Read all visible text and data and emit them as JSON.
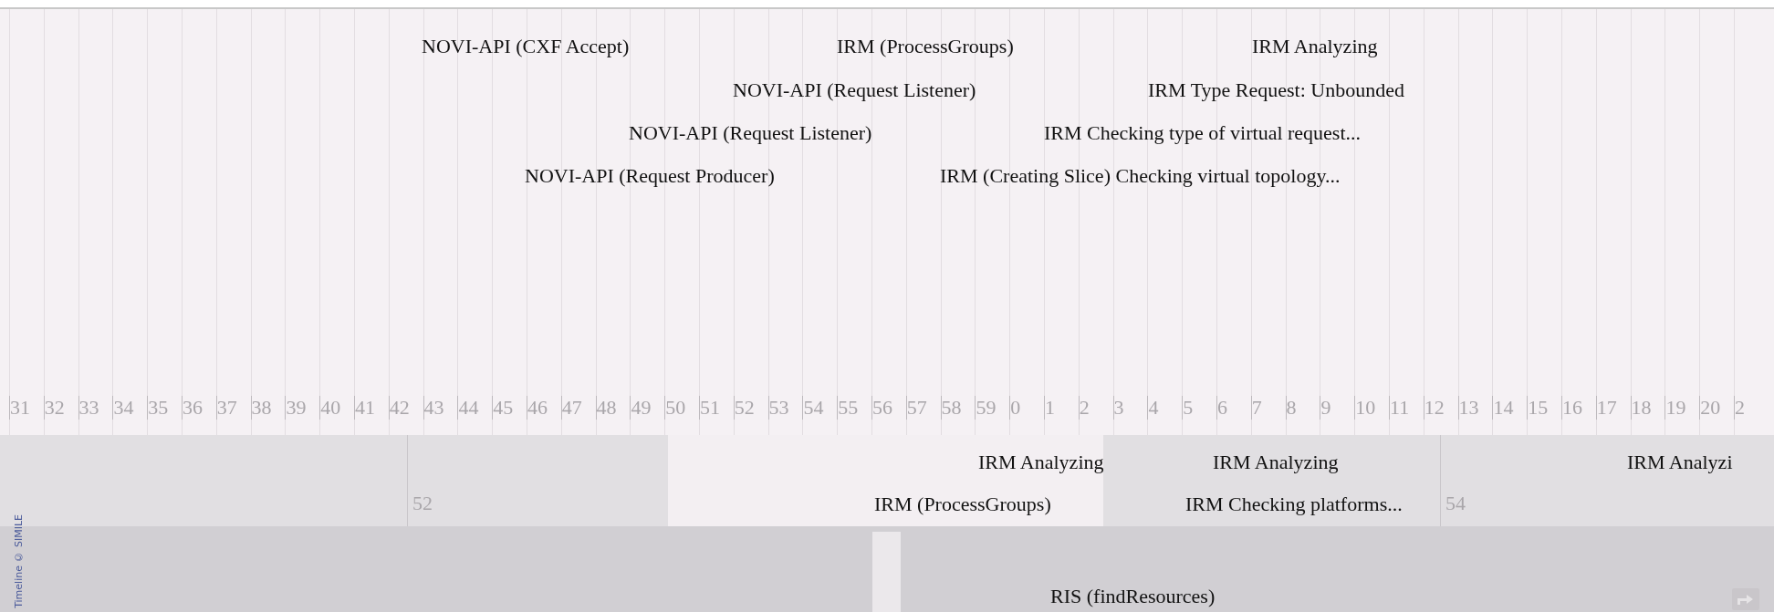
{
  "top_band": {
    "rows": [
      [
        "NOVI-API (CXF Accept)",
        "IRM (ProcessGroups)",
        "IRM Analyzing"
      ],
      [
        "NOVI-API (Request Listener)",
        "IRM Type Request: Unbounded"
      ],
      [
        "NOVI-API (Request Listener)",
        "IRM Checking type of virtual request..."
      ],
      [
        "NOVI-API (Request Producer)",
        "IRM (Creating Slice) Checking virtual topology..."
      ]
    ],
    "ticks": [
      "31",
      "32",
      "33",
      "34",
      "35",
      "36",
      "37",
      "38",
      "39",
      "40",
      "41",
      "42",
      "43",
      "44",
      "45",
      "46",
      "47",
      "48",
      "49",
      "50",
      "51",
      "52",
      "53",
      "54",
      "55",
      "56",
      "57",
      "58",
      "59",
      "0",
      "1",
      "2",
      "3",
      "4",
      "5",
      "6",
      "7",
      "8",
      "9",
      "10",
      "11",
      "12",
      "13",
      "14",
      "15",
      "16",
      "17",
      "18",
      "19",
      "20",
      "2"
    ]
  },
  "middle_band": {
    "rows": [
      [
        "IRM Analyzing",
        "IRM Analyzing",
        "IRM Analyzi"
      ],
      [
        "IRM (ProcessGroups)",
        "IRM Checking platforms..."
      ]
    ],
    "ticks": [
      "52",
      "54"
    ]
  },
  "bottom_band": {
    "rows": [
      [
        "RIS (findResources)"
      ]
    ]
  },
  "credit": "Timeline © SIMILE"
}
